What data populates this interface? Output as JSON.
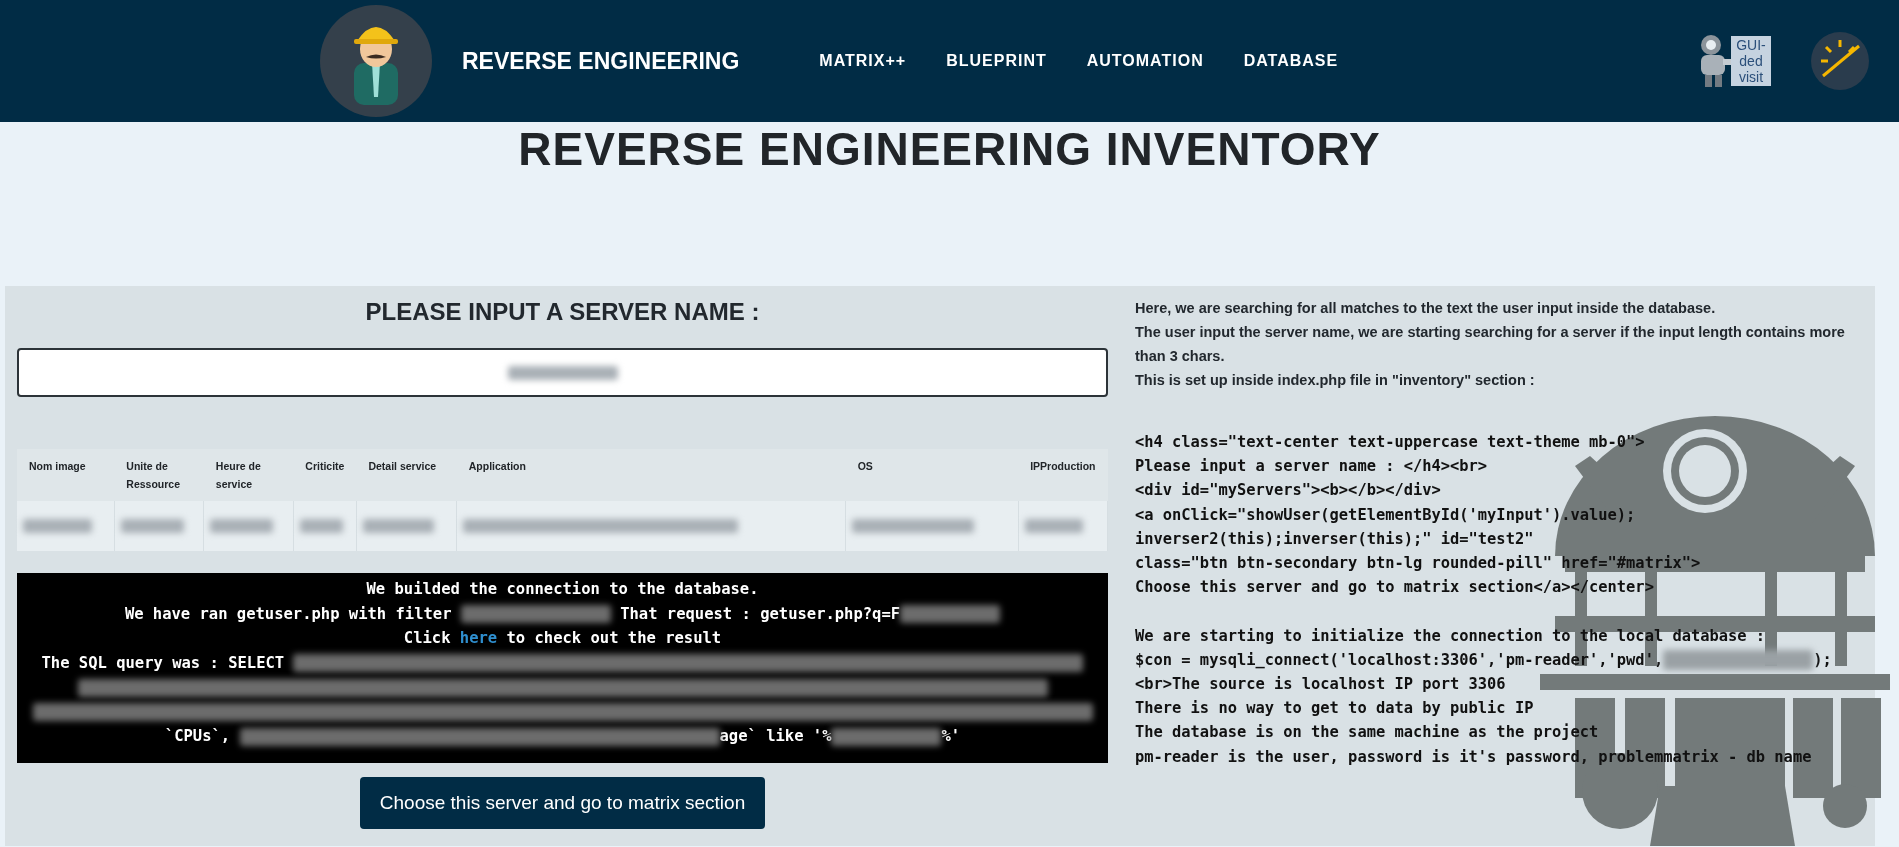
{
  "navbar": {
    "brand": "REVERSE ENGINEERING",
    "links": [
      {
        "label": "MATRIX++"
      },
      {
        "label": "BLUEPRINT"
      },
      {
        "label": "AUTOMATION"
      },
      {
        "label": "DATABASE"
      }
    ],
    "guided_visit": "GUI-ded visit"
  },
  "page_title": "REVERSE ENGINEERING INVENTORY",
  "search": {
    "title": "PLEASE INPUT A SERVER NAME :"
  },
  "table": {
    "columns": [
      "Nom image",
      "Unite de Ressource",
      "Heure de service",
      "Criticite",
      "Detail service",
      "Application",
      "OS",
      "IPProduction"
    ]
  },
  "console": {
    "lines": [
      [
        {
          "kind": "text",
          "text": "We builded the connection to the database."
        }
      ],
      [
        {
          "kind": "text",
          "text": "We have ran getuser.php with filter "
        },
        {
          "kind": "redacted"
        },
        {
          "kind": "text",
          "text": " That request : getuser.php?q=F"
        },
        {
          "kind": "redacted"
        }
      ],
      [
        {
          "kind": "text",
          "text": "Click "
        },
        {
          "kind": "link",
          "text": "here"
        },
        {
          "kind": "text",
          "text": " to check out the result"
        }
      ],
      [
        {
          "kind": "text",
          "text": "The SQL query was : SELECT "
        },
        {
          "kind": "redacted"
        }
      ],
      [
        {
          "kind": "redacted"
        }
      ],
      [
        {
          "kind": "redacted"
        }
      ],
      [
        {
          "kind": "text",
          "text": "`CPUs`, "
        },
        {
          "kind": "redacted"
        },
        {
          "kind": "text",
          "text": "age` like '%"
        },
        {
          "kind": "redacted"
        },
        {
          "kind": "text",
          "text": "%'"
        }
      ]
    ]
  },
  "choose_button": "Choose this server and go to matrix section",
  "explanation": {
    "paragraphs": [
      "Here, we are searching for all matches to the text the user input inside the database.",
      "The user input the server name, we are starting searching for a server if the input length contains more than 3 chars.",
      "This is set up inside index.php file in \"inventory\" section :"
    ],
    "code_blocks": [
      [
        [
          {
            "kind": "text",
            "text": "<h4 class=\"text-center text-uppercase text-theme mb-0\">"
          }
        ],
        [
          {
            "kind": "text",
            "text": "Please input a server name : </h4><br>"
          }
        ],
        [
          {
            "kind": "text",
            "text": "<div id=\"myServers\"><b></b></div>"
          }
        ],
        [
          {
            "kind": "text",
            "text": "<a onClick=\"showUser(getElementById('myInput').value);"
          }
        ],
        [
          {
            "kind": "text",
            "text": "inverser2(this);inverser(this);\" id=\"test2\""
          }
        ],
        [
          {
            "kind": "text",
            "text": "class=\"btn btn-secondary btn-lg rounded-pill\" href=\"#matrix\">"
          }
        ],
        [
          {
            "kind": "text",
            "text": "Choose this server and go to matrix section</a></center>"
          }
        ]
      ],
      [
        [
          {
            "kind": "text",
            "text": "We are starting to initialize the connection to the local database :"
          }
        ],
        [
          {
            "kind": "text",
            "text": "$con = mysqli_connect('localhost:3306','pm-reader','pwd',"
          },
          {
            "kind": "redacted"
          },
          {
            "kind": "text",
            "text": ");"
          }
        ],
        [
          {
            "kind": "text",
            "text": "<br>The source is localhost IP port 3306"
          }
        ],
        [
          {
            "kind": "text",
            "text": "There is no way to get to data by public IP"
          }
        ],
        [
          {
            "kind": "text",
            "text": "The database is on the same machine as the project"
          }
        ],
        [
          {
            "kind": "text",
            "text": "pm-reader is the user, password is it's password, problemmatrix - db name"
          }
        ]
      ]
    ]
  }
}
